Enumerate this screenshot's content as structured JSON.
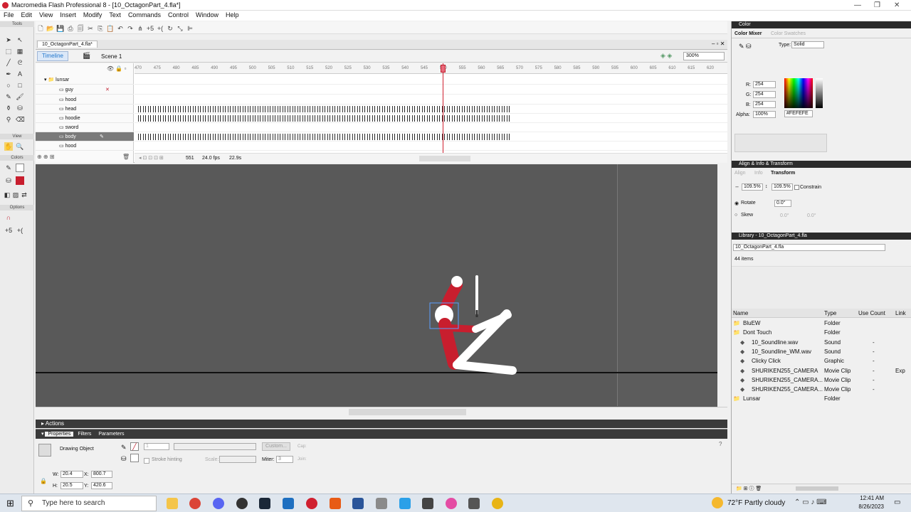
{
  "window": {
    "title": "Macromedia Flash Professional 8 - [10_OctagonPart_4.fla*]"
  },
  "menu": [
    "File",
    "Edit",
    "View",
    "Insert",
    "Modify",
    "Text",
    "Commands",
    "Control",
    "Window",
    "Help"
  ],
  "tools": {
    "header": "Tools",
    "view": "View",
    "colors": "Colors",
    "options": "Options"
  },
  "document": {
    "tab": "10_OctagonPart_4.fla*",
    "timeline_btn": "Timeline",
    "scene": "Scene 1",
    "zoom": "300%"
  },
  "layers": [
    {
      "name": "lunsar"
    },
    {
      "name": "guy"
    },
    {
      "name": "hood"
    },
    {
      "name": "head"
    },
    {
      "name": "hoodie"
    },
    {
      "name": "sword"
    },
    {
      "name": "body"
    },
    {
      "name": "hood"
    }
  ],
  "ruler_ticks": [
    "470",
    "475",
    "480",
    "485",
    "490",
    "495",
    "500",
    "505",
    "510",
    "515",
    "520",
    "525",
    "530",
    "535",
    "540",
    "545",
    "550",
    "555",
    "560",
    "565",
    "570",
    "575",
    "580",
    "585",
    "590",
    "595",
    "600",
    "605",
    "610",
    "615",
    "620"
  ],
  "timeline_status": {
    "frame": "551",
    "fps": "24.0 fps",
    "time": "22.9s"
  },
  "panels": {
    "actions": "Actions",
    "props_tabs": [
      "Properties",
      "Filters",
      "Parameters"
    ],
    "props_type": "Drawing Object",
    "stroke_hinting": "Stroke hinting",
    "scale": "Scale:",
    "miter": "Miter:",
    "miter_val": "3",
    "custom": "Custom...",
    "cap": "Cap:",
    "join": "Join:",
    "w": "20.4",
    "h": "20.5",
    "x": "800.7",
    "y": "420.6",
    "stroke_val": "1"
  },
  "color": {
    "title": "Color",
    "tab1": "Color Mixer",
    "tab2": "Color Swatches",
    "type_label": "Type:",
    "type": "Solid",
    "r": "254",
    "g": "254",
    "b": "254",
    "alpha": "100%",
    "hex": "#FEFEFE"
  },
  "transform": {
    "title": "Align & Info & Transform",
    "tabs": [
      "Align",
      "Info",
      "Transform"
    ],
    "w": "109.5%",
    "h": "109.5%",
    "constrain": "Constrain",
    "rotate": "Rotate",
    "rotate_val": "0.0°",
    "skew": "Skew",
    "skew_val1": "0.0°",
    "skew_val2": "0.0°"
  },
  "library": {
    "title": "Library - 10_OctagonPart_4.fla",
    "select": "10_OctagonPart_4.fla",
    "count": "44 items",
    "columns": [
      "Name",
      "Type",
      "Use Count",
      "Link"
    ],
    "rows": [
      {
        "name": "BluEW",
        "type": "Folder",
        "count": "",
        "link": ""
      },
      {
        "name": "Dont Touch",
        "type": "Folder",
        "count": "",
        "link": ""
      },
      {
        "name": "10_Soundline.wav",
        "type": "Sound",
        "count": "-",
        "link": ""
      },
      {
        "name": "10_Soundline_WM.wav",
        "type": "Sound",
        "count": "-",
        "link": ""
      },
      {
        "name": "Clicky Click",
        "type": "Graphic",
        "count": "-",
        "link": ""
      },
      {
        "name": "SHURIKEN255_CAMERA",
        "type": "Movie Clip",
        "count": "-",
        "link": "Exp"
      },
      {
        "name": "SHURIKEN255_CAMERA...",
        "type": "Movie Clip",
        "count": "-",
        "link": ""
      },
      {
        "name": "SHURIKEN255_CAMERA...",
        "type": "Movie Clip",
        "count": "-",
        "link": ""
      },
      {
        "name": "Lunsar",
        "type": "Folder",
        "count": "",
        "link": ""
      }
    ]
  },
  "taskbar": {
    "search": "Type here to search",
    "weather": "72°F  Partly cloudy",
    "time": "12:41 AM",
    "date": "8/26/2023"
  }
}
